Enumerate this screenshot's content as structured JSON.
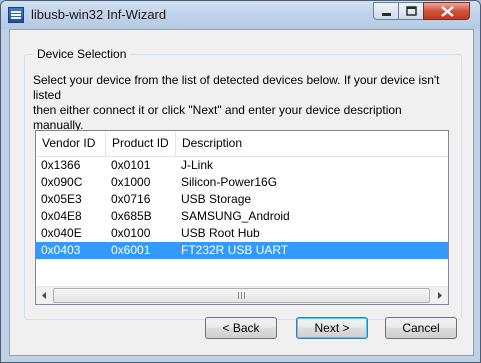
{
  "window": {
    "title": "libusb-win32 Inf-Wizard"
  },
  "group": {
    "title": "Device Selection",
    "intro": "Select your device from the list of detected devices below. If your device isn't listed\nthen either connect it or click \"Next\" and enter your device description manually."
  },
  "table": {
    "columns": [
      "Vendor ID",
      "Product ID",
      "Description"
    ],
    "rows": [
      {
        "vendor": "0x1366",
        "product": "0x0101",
        "description": "J-Link",
        "selected": false
      },
      {
        "vendor": "0x090C",
        "product": "0x1000",
        "description": "Silicon-Power16G",
        "selected": false
      },
      {
        "vendor": "0x05E3",
        "product": "0x0716",
        "description": "USB Storage",
        "selected": false
      },
      {
        "vendor": "0x04E8",
        "product": "0x685B",
        "description": "SAMSUNG_Android",
        "selected": false
      },
      {
        "vendor": "0x040E",
        "product": "0x0100",
        "description": "USB Root Hub",
        "selected": false
      },
      {
        "vendor": "0x0403",
        "product": "0x6001",
        "description": "FT232R USB UART",
        "selected": true
      }
    ]
  },
  "buttons": {
    "back": "< Back",
    "next": "Next >",
    "cancel": "Cancel"
  },
  "colors": {
    "selection": "#3399ff",
    "close_button": "#c7361c"
  }
}
